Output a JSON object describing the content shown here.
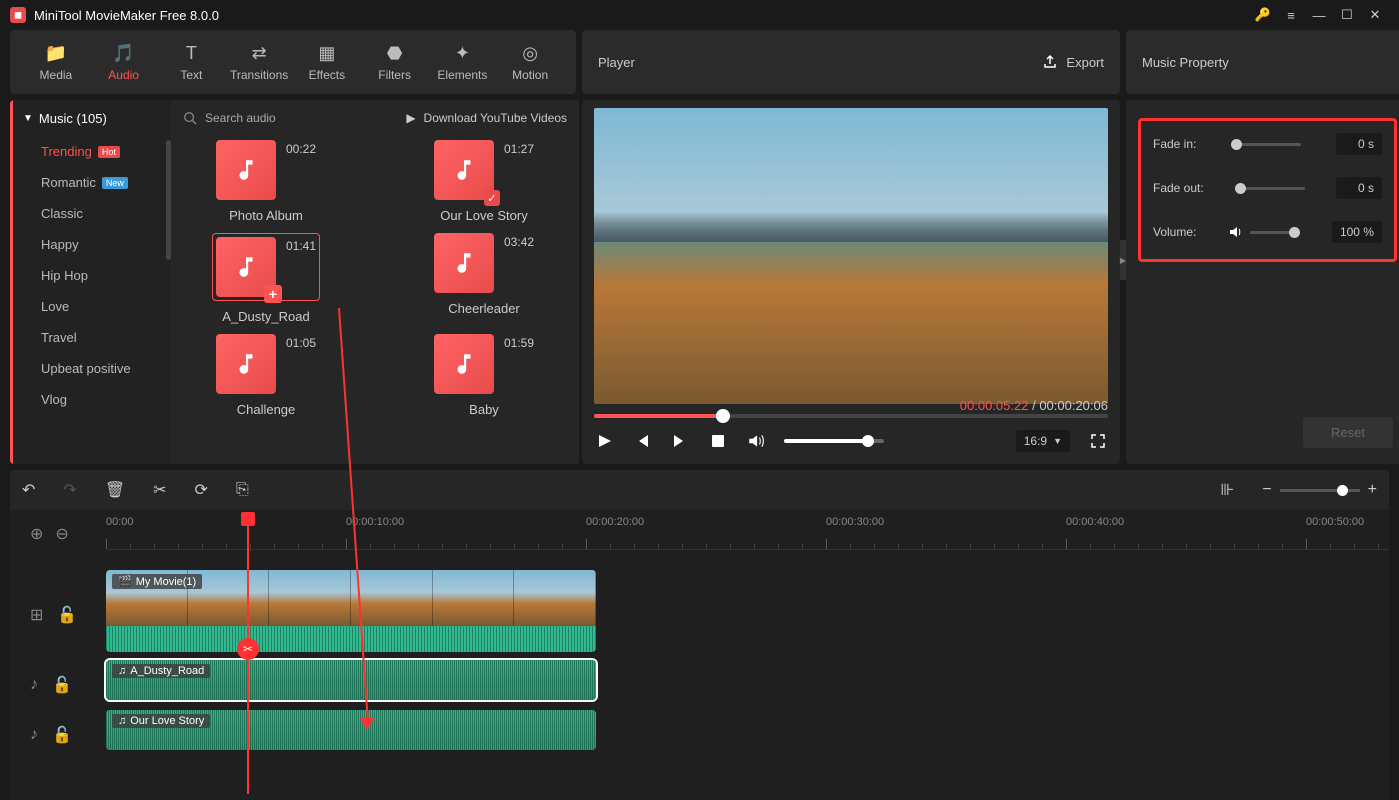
{
  "titlebar": {
    "title": "MiniTool MovieMaker Free 8.0.0"
  },
  "tabs": {
    "media": "Media",
    "audio": "Audio",
    "text": "Text",
    "transitions": "Transitions",
    "effects": "Effects",
    "filters": "Filters",
    "elements": "Elements",
    "motion": "Motion"
  },
  "player_label": "Player",
  "export_label": "Export",
  "property_label": "Music Property",
  "music_header": "Music (105)",
  "categories": [
    {
      "label": "Trending",
      "badge": "Hot",
      "active": true
    },
    {
      "label": "Romantic",
      "badge": "New"
    },
    {
      "label": "Classic"
    },
    {
      "label": "Happy"
    },
    {
      "label": "Hip Hop"
    },
    {
      "label": "Love"
    },
    {
      "label": "Travel"
    },
    {
      "label": "Upbeat positive"
    },
    {
      "label": "Vlog"
    }
  ],
  "search_placeholder": "Search audio",
  "yt_label": "Download YouTube Videos",
  "audios": [
    {
      "name": "Photo Album",
      "dur": "00:22"
    },
    {
      "name": "Our Love Story",
      "dur": "01:27",
      "checked": true
    },
    {
      "name": "A_Dusty_Road",
      "dur": "01:41",
      "selected": true,
      "add": true
    },
    {
      "name": "Cheerleader",
      "dur": "03:42"
    },
    {
      "name": "Challenge",
      "dur": "01:05"
    },
    {
      "name": "Baby",
      "dur": "01:59"
    }
  ],
  "time": {
    "current": "00:00:05:22",
    "total": "00:00:20:06",
    "sep": " / "
  },
  "aspect": "16:9",
  "props": {
    "fade_in_label": "Fade in:",
    "fade_in_val": "0 s",
    "fade_out_label": "Fade out:",
    "fade_out_val": "0 s",
    "volume_label": "Volume:",
    "volume_val": "100 %"
  },
  "reset_label": "Reset",
  "ruler": [
    "00:00",
    "00:00:10:00",
    "00:00:20:00",
    "00:00:30:00",
    "00:00:40:00",
    "00:00:50:00"
  ],
  "clips": {
    "video": "My Movie(1)",
    "audio1": "A_Dusty_Road",
    "audio2": "Our Love Story"
  }
}
